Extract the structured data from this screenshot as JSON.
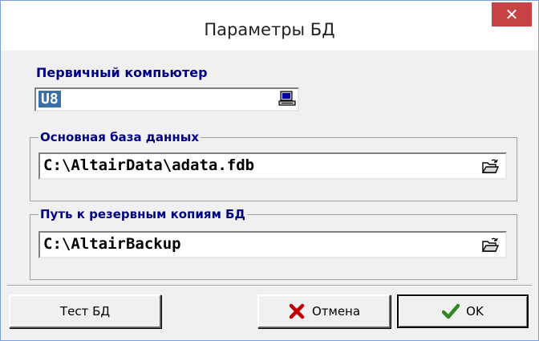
{
  "window": {
    "title": "Параметры БД",
    "close_glyph": "✕"
  },
  "primary": {
    "label": "Первичный компьютер",
    "value": "U8",
    "icon": "computer-icon"
  },
  "main_db": {
    "label": "Основная база данных",
    "path": "C:\\AltairData\\adata.fdb",
    "icon": "folder-open-icon"
  },
  "backup": {
    "label": "Путь к резервным копиям БД",
    "path": "C:\\AltairBackup",
    "icon": "folder-open-icon"
  },
  "buttons": {
    "test": "Тест БД",
    "cancel": "Отмена",
    "ok": "OK"
  },
  "colors": {
    "label": "#000080",
    "close": "#c74242",
    "selection": "#3a6fa8",
    "cancel_icon": "#c00000",
    "ok_icon": "#2e8b1e"
  }
}
